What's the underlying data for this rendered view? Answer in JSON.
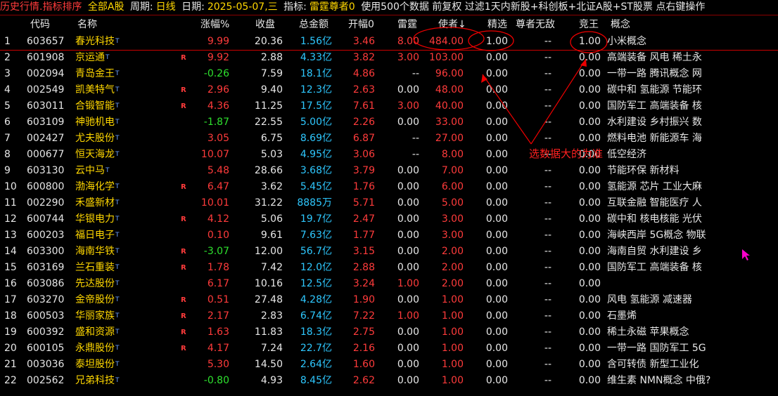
{
  "topbar": {
    "title": "历史行情.指标排序",
    "market": "全部A股",
    "period_label": "周期:",
    "period": "日线",
    "date_label": "日期:",
    "date": "2025-05-07,三",
    "indicator_label": "指标:",
    "indicator": "雷霆尊者0",
    "info": "使用500个数据 前复权 过滤1天内新股+科创板+北证A股+ST股票 点右键操作"
  },
  "columns": [
    "代码",
    "名称",
    "涨幅%",
    "收盘",
    "总金额",
    "开幅0",
    "雷霆",
    "使者↓",
    "精选",
    "尊者无敌",
    "竞王",
    "概念"
  ],
  "rows": [
    {
      "idx": "1",
      "code": "603657",
      "name": "春光科技",
      "r": "",
      "chg": "9.99",
      "close": "20.36",
      "amount": "1.56亿",
      "open": "3.46",
      "leiting": "8.00",
      "shizhe": "484.00",
      "jingxuan": "1.00",
      "zunzhe": "--",
      "jingwang": "1.00",
      "concept": "小米概念"
    },
    {
      "idx": "2",
      "code": "601908",
      "name": "京运通",
      "r": "R",
      "chg": "9.92",
      "close": "2.88",
      "amount": "4.33亿",
      "open": "3.82",
      "leiting": "3.00",
      "shizhe": "103.00",
      "jingxuan": "0.00",
      "zunzhe": "--",
      "jingwang": "0.00",
      "concept": "高端装备 风电 稀土永"
    },
    {
      "idx": "3",
      "code": "002094",
      "name": "青岛金王",
      "r": "",
      "chg": "-0.26",
      "close": "7.59",
      "amount": "18.1亿",
      "open": "4.86",
      "leiting": "--",
      "shizhe": "96.00",
      "jingxuan": "0.00",
      "zunzhe": "--",
      "jingwang": "0.00",
      "concept": "一带一路 腾讯概念 网"
    },
    {
      "idx": "4",
      "code": "002549",
      "name": "凯美特气",
      "r": "R",
      "chg": "2.96",
      "close": "9.40",
      "amount": "12.3亿",
      "open": "2.63",
      "leiting": "0.00",
      "shizhe": "48.00",
      "jingxuan": "0.00",
      "zunzhe": "--",
      "jingwang": "0.00",
      "concept": "碳中和 氢能源 节能环"
    },
    {
      "idx": "5",
      "code": "603011",
      "name": "合锻智能",
      "r": "R",
      "chg": "4.36",
      "close": "11.25",
      "amount": "17.5亿",
      "open": "7.61",
      "leiting": "3.00",
      "shizhe": "40.00",
      "jingxuan": "0.00",
      "zunzhe": "--",
      "jingwang": "0.00",
      "concept": "国防军工 高端装备 核"
    },
    {
      "idx": "6",
      "code": "603109",
      "name": "神驰机电",
      "r": "",
      "chg": "-1.87",
      "close": "22.55",
      "amount": "5.00亿",
      "open": "2.26",
      "leiting": "0.00",
      "shizhe": "33.00",
      "jingxuan": "0.00",
      "zunzhe": "--",
      "jingwang": "0.00",
      "concept": "水利建设 乡村振兴 数"
    },
    {
      "idx": "7",
      "code": "002427",
      "name": "尤夫股份",
      "r": "",
      "chg": "3.05",
      "close": "6.75",
      "amount": "8.69亿",
      "open": "6.87",
      "leiting": "--",
      "shizhe": "27.00",
      "jingxuan": "0.00",
      "zunzhe": "--",
      "jingwang": "0.00",
      "concept": "燃料电池 新能源车 海"
    },
    {
      "idx": "8",
      "code": "000677",
      "name": "恒天海龙",
      "r": "",
      "chg": "10.07",
      "close": "5.03",
      "amount": "4.95亿",
      "open": "3.06",
      "leiting": "--",
      "shizhe": "8.00",
      "jingxuan": "0.00",
      "zunzhe": "--",
      "jingwang": "0.00",
      "concept": "低空经济"
    },
    {
      "idx": "9",
      "code": "603130",
      "name": "云中马",
      "r": "",
      "chg": "5.48",
      "close": "28.66",
      "amount": "3.68亿",
      "open": "3.79",
      "leiting": "0.00",
      "shizhe": "7.00",
      "jingxuan": "0.00",
      "zunzhe": "--",
      "jingwang": "0.00",
      "concept": "节能环保 新材料"
    },
    {
      "idx": "10",
      "code": "600800",
      "name": "渤海化学",
      "r": "R",
      "chg": "6.47",
      "close": "3.62",
      "amount": "5.45亿",
      "open": "1.76",
      "leiting": "0.00",
      "shizhe": "6.00",
      "jingxuan": "0.00",
      "zunzhe": "--",
      "jingwang": "0.00",
      "concept": "氢能源 芯片 工业大麻"
    },
    {
      "idx": "11",
      "code": "002290",
      "name": "禾盛新材",
      "r": "",
      "chg": "10.01",
      "close": "31.22",
      "amount": "8885万",
      "open": "5.71",
      "leiting": "0.00",
      "shizhe": "5.00",
      "jingxuan": "0.00",
      "zunzhe": "--",
      "jingwang": "0.00",
      "concept": "互联金融 智能医疗 人"
    },
    {
      "idx": "12",
      "code": "600744",
      "name": "华银电力",
      "r": "R",
      "chg": "4.12",
      "close": "5.06",
      "amount": "19.7亿",
      "open": "2.47",
      "leiting": "0.00",
      "shizhe": "3.00",
      "jingxuan": "0.00",
      "zunzhe": "--",
      "jingwang": "0.00",
      "concept": "碳中和 核电核能 光伏"
    },
    {
      "idx": "13",
      "code": "600203",
      "name": "福日电子",
      "r": "",
      "chg": "0.10",
      "close": "9.61",
      "amount": "7.63亿",
      "open": "1.77",
      "leiting": "0.00",
      "shizhe": "3.00",
      "jingxuan": "0.00",
      "zunzhe": "--",
      "jingwang": "0.00",
      "concept": "海峡西岸 5G概念 物联"
    },
    {
      "idx": "14",
      "code": "603300",
      "name": "海南华铁",
      "r": "R",
      "chg": "-3.07",
      "close": "12.00",
      "amount": "56.7亿",
      "open": "3.15",
      "leiting": "0.00",
      "shizhe": "2.00",
      "jingxuan": "0.00",
      "zunzhe": "--",
      "jingwang": "0.00",
      "concept": "海南自贸 水利建设 乡"
    },
    {
      "idx": "15",
      "code": "603169",
      "name": "兰石重装",
      "r": "R",
      "chg": "1.78",
      "close": "7.42",
      "amount": "12.0亿",
      "open": "2.88",
      "leiting": "0.00",
      "shizhe": "2.00",
      "jingxuan": "0.00",
      "zunzhe": "--",
      "jingwang": "0.00",
      "concept": "国防军工 高端装备 核"
    },
    {
      "idx": "16",
      "code": "603086",
      "name": "先达股份",
      "r": "",
      "chg": "6.17",
      "close": "10.16",
      "amount": "12.5亿",
      "open": "3.24",
      "leiting": "1.00",
      "shizhe": "2.00",
      "jingxuan": "0.00",
      "zunzhe": "--",
      "jingwang": "0.00",
      "concept": ""
    },
    {
      "idx": "17",
      "code": "603270",
      "name": "金帝股份",
      "r": "R",
      "chg": "0.51",
      "close": "27.48",
      "amount": "4.28亿",
      "open": "1.90",
      "leiting": "0.00",
      "shizhe": "1.00",
      "jingxuan": "0.00",
      "zunzhe": "--",
      "jingwang": "0.00",
      "concept": "风电 氢能源 减速器"
    },
    {
      "idx": "18",
      "code": "600503",
      "name": "华丽家族",
      "r": "R",
      "chg": "2.17",
      "close": "2.83",
      "amount": "6.74亿",
      "open": "7.22",
      "leiting": "1.00",
      "shizhe": "1.00",
      "jingxuan": "0.00",
      "zunzhe": "--",
      "jingwang": "0.00",
      "concept": "石墨烯"
    },
    {
      "idx": "19",
      "code": "600392",
      "name": "盛和资源",
      "r": "R",
      "chg": "1.63",
      "close": "11.83",
      "amount": "18.3亿",
      "open": "2.75",
      "leiting": "0.00",
      "shizhe": "1.00",
      "jingxuan": "0.00",
      "zunzhe": "--",
      "jingwang": "0.00",
      "concept": "稀土永磁 苹果概念"
    },
    {
      "idx": "20",
      "code": "600105",
      "name": "永鼎股份",
      "r": "R",
      "chg": "4.17",
      "close": "7.24",
      "amount": "22.7亿",
      "open": "2.16",
      "leiting": "0.00",
      "shizhe": "1.00",
      "jingxuan": "0.00",
      "zunzhe": "--",
      "jingwang": "0.00",
      "concept": "一带一路 国防军工 5G"
    },
    {
      "idx": "21",
      "code": "003036",
      "name": "泰坦股份",
      "r": "",
      "chg": "5.30",
      "close": "14.50",
      "amount": "2.64亿",
      "open": "1.60",
      "leiting": "0.00",
      "shizhe": "1.00",
      "jingxuan": "0.00",
      "zunzhe": "--",
      "jingwang": "0.00",
      "concept": "含可转债 新型工业化"
    },
    {
      "idx": "22",
      "code": "002562",
      "name": "兄弟科技",
      "r": "",
      "chg": "-0.80",
      "close": "4.93",
      "amount": "8.45亿",
      "open": "2.62",
      "leiting": "0.00",
      "shizhe": "1.00",
      "jingxuan": "0.00",
      "zunzhe": "--",
      "jingwang": "0.00",
      "concept": "维生素 NMN概念 中俄?"
    }
  ],
  "annotation": {
    "text": "选数据大的为准"
  },
  "colors": {
    "up": "#ff3b3b",
    "down": "#2ee02e",
    "amount": "#2ec8ff",
    "name": "#ffd700"
  }
}
